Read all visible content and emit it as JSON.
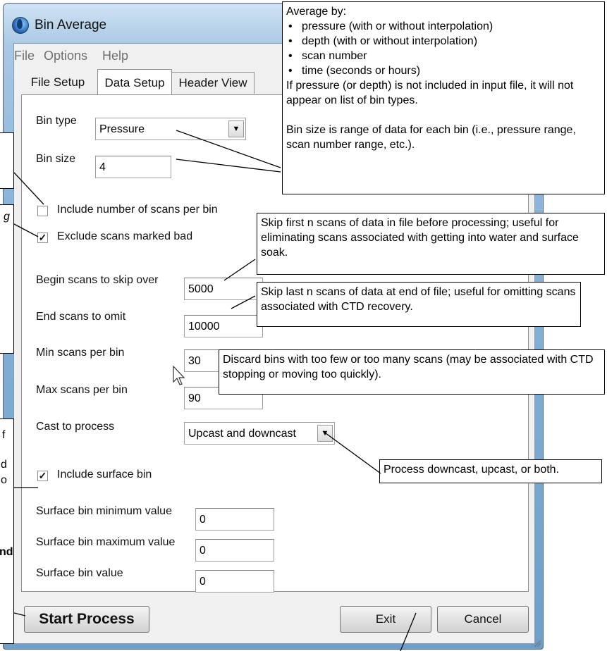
{
  "window": {
    "title": "Bin Average"
  },
  "menu": {
    "file": "File",
    "options": "Options",
    "help": "Help"
  },
  "tabs": [
    {
      "label": "File Setup",
      "active": false
    },
    {
      "label": "Data Setup",
      "active": true
    },
    {
      "label": "Header View",
      "active": false
    }
  ],
  "form": {
    "bin_type": {
      "label": "Bin type",
      "value": "Pressure"
    },
    "bin_size": {
      "label": "Bin size",
      "value": "4"
    },
    "include_scans_per_bin": {
      "label": "Include number of scans per bin",
      "checked": false
    },
    "exclude_bad": {
      "label": "Exclude scans marked bad",
      "checked": true
    },
    "begin_skip": {
      "label": "Begin scans to skip over",
      "value": "5000"
    },
    "end_omit": {
      "label": "End scans to omit",
      "value": "10000"
    },
    "min_scans": {
      "label": "Min scans per bin",
      "value": "30"
    },
    "max_scans": {
      "label": "Max scans per bin",
      "value": "90"
    },
    "cast": {
      "label": "Cast to process",
      "value": "Upcast and downcast"
    },
    "include_surface": {
      "label": "Include surface bin",
      "checked": true
    },
    "surface_min": {
      "label": "Surface bin minimum value",
      "value": "0"
    },
    "surface_max": {
      "label": "Surface bin maximum value",
      "value": "0"
    },
    "surface_value": {
      "label": "Surface bin value",
      "value": "0"
    }
  },
  "buttons": {
    "start": "Start Process",
    "exit": "Exit",
    "cancel": "Cancel"
  },
  "callouts": {
    "bin_type": {
      "heading": "Average by:",
      "items": [
        "pressure (with or without interpolation)",
        "depth (with or without interpolation)",
        "scan number",
        "time (seconds or hours)"
      ],
      "note1": "If pressure (or depth) is not included in input file, it will not appear on list of bin types.",
      "note2": "Bin size is range of data for each bin (i.e., pressure range, scan number range, etc.)."
    },
    "begin_skip": "Skip first n scans of data in file before processing; useful for eliminating scans associated with getting into water and surface soak.",
    "end_omit": "Skip last n scans of data at end of file; useful for omitting scans associated with CTD recovery.",
    "min_max": "Discard bins with too few or too many scans (may be associated with CTD stopping or moving too quickly).",
    "cast": "Process downcast, upcast, or both.",
    "left_fragments": {
      "g": "g",
      "f": "f",
      "d": "d",
      "o": "o",
      "nd": "nd"
    }
  },
  "colors": {
    "titlebar_top": "#cfe3f3",
    "titlebar_bottom": "#6d9fc9",
    "panel": "#ffffff",
    "frame": "#f0f0f0"
  }
}
